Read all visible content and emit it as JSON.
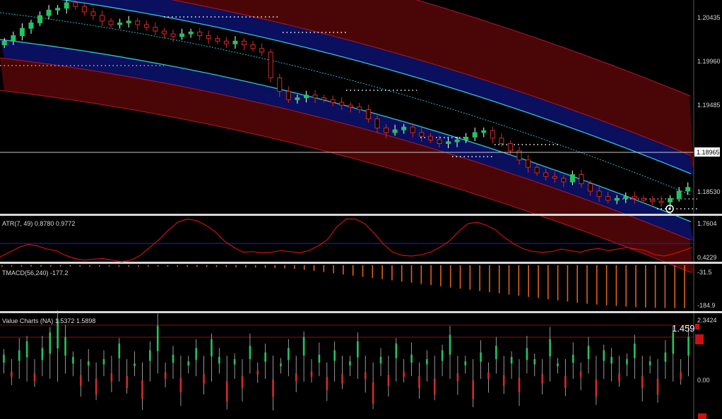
{
  "colors": {
    "background": "#000000",
    "up_candle": "#22c55e",
    "down_candle": "#d42a2a",
    "band_outer_fill": "#4a0606",
    "band_inner_fill": "#0a0f5e",
    "band_outer_line": "#b01830",
    "band_center_line": "#2ec6d6",
    "atr_line": "#cc1010",
    "atr_level": "#2020e0",
    "tmacd_bar": "#e0601a",
    "separator": "#d8d8d8",
    "value_ob_line": "#8a1010"
  },
  "main": {
    "price_ticks": [
      "1.20435",
      "1.19960",
      "1.19485",
      "1.18530"
    ],
    "current_price": "1.18965"
  },
  "atr_panel": {
    "title": "ATR(7, 49) 0.8780 0.9772",
    "scale_top": "1.7604",
    "scale_bottom": "0.4229"
  },
  "tmacd_panel": {
    "title": "TMACD(56,240) -177.2",
    "scale_top": "-31.5",
    "scale_bottom": "-184.9"
  },
  "value_panel": {
    "title": "Value Charts (NA) 1.5372 1.5898",
    "scale_top": "2.3424",
    "scale_mid": "0.00",
    "current_value": "1.459"
  },
  "chart_data": [
    {
      "type": "line",
      "title": "",
      "series": [
        {
          "values": [
            1.203,
            1.2036,
            1.2044,
            1.205,
            1.2058,
            1.2064,
            1.2066,
            1.2072,
            1.2068,
            1.2062,
            1.2058,
            1.2052,
            1.2048,
            1.205,
            1.2052,
            1.2048,
            1.2045,
            1.2041,
            1.2038,
            1.2035,
            1.2038,
            1.204,
            1.2036,
            1.2033,
            1.203,
            1.2027,
            1.203,
            1.2026,
            1.2022,
            1.2018,
            1.199,
            1.1975,
            1.1966,
            1.1968,
            1.1971,
            1.1968,
            1.1966,
            1.1963,
            1.196,
            1.1958,
            1.1955,
            1.1945,
            1.1935,
            1.193,
            1.1933,
            1.1936,
            1.193,
            1.1926,
            1.1922,
            1.1918,
            1.192,
            1.1922,
            1.1925,
            1.193,
            1.1932,
            1.1924,
            1.1918,
            1.191,
            1.19,
            1.1892,
            1.1886,
            1.1882,
            1.188,
            1.1876,
            1.1884,
            1.1874,
            1.1866,
            1.186,
            1.1856,
            1.1858,
            1.186,
            1.1858,
            1.1856,
            1.1855,
            1.1854,
            1.1858,
            1.1866,
            1.187
          ]
        }
      ],
      "y_ticks": [
        "1.20435",
        "1.19960",
        "1.19485",
        "1.18530"
      ],
      "current_price": 1.18965,
      "grid": false
    },
    {
      "type": "line",
      "title": "ATR(7, 49) 0.8780 0.9772",
      "series": [
        {
          "values": [
            0.55,
            0.7,
            0.85,
            0.95,
            0.9,
            0.8,
            0.75,
            0.6,
            0.5,
            0.45,
            0.48,
            0.5,
            0.45,
            0.4,
            0.45,
            0.6,
            0.85,
            1.1,
            1.4,
            1.65,
            1.75,
            1.7,
            1.55,
            1.35,
            1.05,
            0.85,
            0.7,
            0.72,
            0.68,
            0.7,
            0.75,
            0.72,
            0.68,
            0.75,
            0.9,
            1.1,
            1.5,
            1.75,
            1.75,
            1.6,
            1.3,
            0.95,
            0.7,
            0.6,
            0.58,
            0.62,
            0.7,
            0.85,
            1.05,
            1.35,
            1.6,
            1.65,
            1.55,
            1.4,
            1.15,
            0.95,
            0.8,
            0.72,
            0.7,
            0.72,
            0.8,
            0.75,
            0.7,
            0.78,
            0.82,
            0.75,
            0.8,
            0.85,
            0.8,
            0.75,
            0.62,
            0.58,
            0.65,
            0.75,
            0.85
          ]
        }
      ],
      "level": 0.9772,
      "ylim": [
        0.4229,
        1.7604
      ]
    },
    {
      "type": "bar",
      "title": "TMACD(56,240) -177.2",
      "series": [
        {
          "values": [
            -31.5,
            -32.0,
            -32.5,
            -33.0,
            -33.2,
            -33.5,
            -33.8,
            -34.0,
            -34.3,
            -34.5,
            -34.8,
            -35.0,
            -35.2,
            -35.5,
            -35.8,
            -36.0,
            -36.3,
            -36.5,
            -36.8,
            -37.0,
            -37.3,
            -37.5,
            -37.8,
            -38.0,
            -38.5,
            -39.0,
            -39.5,
            -40.0,
            -41.0,
            -42.0,
            -44.0,
            -47.0,
            -51.0,
            -55.0,
            -59.0,
            -63.0,
            -67.0,
            -71.0,
            -75.0,
            -79.0,
            -83.0,
            -87.0,
            -91.0,
            -95.0,
            -99.0,
            -103.0,
            -107.0,
            -111.0,
            -115.0,
            -119.0,
            -123.0,
            -127.0,
            -131.0,
            -135.0,
            -139.0,
            -143.0,
            -147.0,
            -151.0,
            -155.0,
            -159.0,
            -162.0,
            -165.0,
            -168.0,
            -170.0,
            -172.0,
            -174.0,
            -175.0,
            -176.0,
            -176.5,
            -177.0,
            -177.2
          ]
        }
      ],
      "ylim": [
        -184.9,
        -31.5
      ]
    },
    {
      "type": "bar",
      "title": "Value Charts (NA) 1.5372 1.5898",
      "series": [
        {
          "values": [
            0.6,
            -0.4,
            0.8,
            1.2,
            -0.6,
            0.9,
            1.6,
            2.2,
            1.4,
            0.5,
            -0.8,
            0.3,
            -1.2,
            0.4,
            -0.6,
            1.1,
            -0.9,
            0.2,
            -1.4,
            0.8,
            1.9,
            -0.5,
            0.6,
            -1.1,
            0.3,
            0.9,
            -0.7,
            1.3,
            0.5,
            -1.5,
            0.4,
            -0.9,
            1.0,
            -0.3,
            0.7,
            -1.3,
            0.2,
            0.9,
            -0.6,
            1.4,
            -0.4,
            0.6,
            -1.0,
            0.8,
            -0.7,
            0.3,
            1.2,
            -0.5,
            -1.6,
            0.5,
            -0.8,
            1.1,
            -0.4,
            0.6,
            -0.9,
            0.4,
            -1.2,
            0.8,
            1.5,
            -0.6,
            0.3,
            -1.4,
            0.7,
            -0.5,
            1.0,
            -0.8,
            0.5,
            -1.1,
            0.9,
            0.4,
            -0.7,
            1.3,
            0.2,
            -0.9,
            0.6,
            -0.4,
            1.0,
            -1.3,
            0.8,
            0.5,
            -0.6,
            0.4,
            1.1,
            -0.9,
            0.3,
            -1.2,
            0.7,
            1.6,
            -0.5,
            1.4
          ]
        }
      ],
      "ylim": [
        -2.3,
        2.3424
      ],
      "overbought_level": 1.459
    }
  ]
}
